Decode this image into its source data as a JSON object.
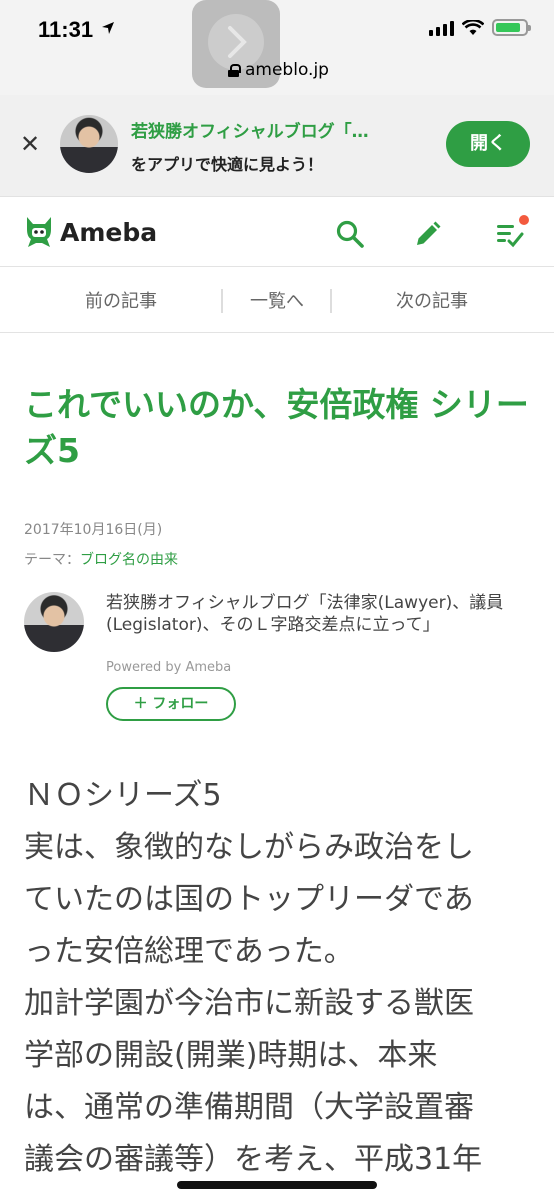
{
  "status_bar": {
    "time": "11:31",
    "battery_level": 0.85
  },
  "browser": {
    "url": "ameblo.jp"
  },
  "app_banner": {
    "title": "若狭勝オフィシャルブログ「…",
    "subtitle": "をアプリで快適に見よう！",
    "open_label": "開く"
  },
  "header": {
    "logo_text": "Ameba",
    "icons": [
      "search-icon",
      "pen-icon",
      "notifications-icon"
    ]
  },
  "article_nav": {
    "prev": "前の記事",
    "list": "一覧へ",
    "next": "次の記事"
  },
  "article": {
    "title": "これでいいのか、安倍政権 シリーズ5",
    "date": "2017年10月16日(月)",
    "theme_label": "テーマ：",
    "theme_link": "ブログ名の由来",
    "author_name": "若狭勝オフィシャルブログ「法律家(Lawyer)、議員(Legislator)、そのＬ字路交差点に立って」",
    "powered_by": "Powered by Ameba",
    "follow_label": "＋ フォロー",
    "body_lines": [
      "ＮＯシリーズ5",
      "実は、象徴的なしがらみ政治をし",
      "ていたのは国のトップリーダであ",
      "った安倍総理であった。",
      "加計学園が今治市に新設する獣医",
      "学部の開設(開業)時期は、本来",
      "は、通常の準備期間（大学設置審",
      "議会の審議等）を考え、平成31年"
    ]
  },
  "colors": {
    "brand_green": "#2f9e44",
    "notification_red": "#f35a3e"
  }
}
